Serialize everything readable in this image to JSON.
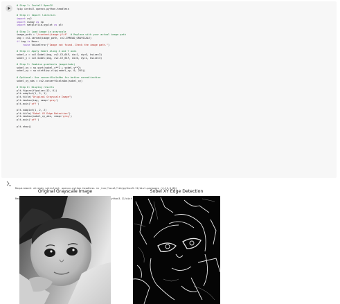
{
  "cell": {
    "code_lines": [
      [
        {
          "t": "# Step 1: Install OpenCV",
          "c": "cmt"
        }
      ],
      [
        {
          "t": "!pip install opencv-python-headless",
          "c": "plain"
        }
      ],
      [],
      [
        {
          "t": "# Step 2: Import libraries",
          "c": "cmt"
        }
      ],
      [
        {
          "t": "import",
          "c": "kw"
        },
        {
          "t": " cv2",
          "c": "plain"
        }
      ],
      [
        {
          "t": "import",
          "c": "kw"
        },
        {
          "t": " numpy ",
          "c": "plain"
        },
        {
          "t": "as",
          "c": "kw"
        },
        {
          "t": " np",
          "c": "plain"
        }
      ],
      [
        {
          "t": "import",
          "c": "kw"
        },
        {
          "t": " matplotlib.pyplot ",
          "c": "plain"
        },
        {
          "t": "as",
          "c": "kw"
        },
        {
          "t": " plt",
          "c": "plain"
        }
      ],
      [],
      [
        {
          "t": "# Step 3: Load image in grayscale",
          "c": "cmt"
        }
      ],
      [
        {
          "t": "image_path = ",
          "c": "plain"
        },
        {
          "t": "\"/content/image.jfif\"",
          "c": "str"
        },
        {
          "t": "  ",
          "c": "plain"
        },
        {
          "t": "# Replace with your actual image path",
          "c": "cmt"
        }
      ],
      [
        {
          "t": "img = cv2.imread(image_path, cv2.IMREAD_GRAYSCALE)",
          "c": "plain"
        }
      ],
      [
        {
          "t": "if",
          "c": "kw"
        },
        {
          "t": " img ",
          "c": "plain"
        },
        {
          "t": "is",
          "c": "kw"
        },
        {
          "t": " None:",
          "c": "plain"
        }
      ],
      [
        {
          "t": "    ",
          "c": "plain"
        },
        {
          "t": "raise",
          "c": "kw"
        },
        {
          "t": " ValueError(",
          "c": "plain"
        },
        {
          "t": "\"Image not found. Check the image path.\"",
          "c": "str"
        },
        {
          "t": ")",
          "c": "plain"
        }
      ],
      [],
      [
        {
          "t": "# Step 4: Apply Sobel along X and Y axes",
          "c": "cmt"
        }
      ],
      [
        {
          "t": "sobel_x = cv2.Sobel(img, cv2.CV_64F, dx=1, dy=0, ksize=3)",
          "c": "plain"
        }
      ],
      [
        {
          "t": "sobel_y = cv2.Sobel(img, cv2.CV_64F, dx=0, dy=1, ksize=3)",
          "c": "plain"
        }
      ],
      [],
      [
        {
          "t": "# Step 5: Combine gradients (magnitude)",
          "c": "cmt"
        }
      ],
      [
        {
          "t": "sobel_xy = np.sqrt(sobel_x**2 + sobel_y**2)",
          "c": "plain"
        }
      ],
      [
        {
          "t": "sobel_xy = np.uint8(np.clip(sobel_xy, 0, 255))",
          "c": "plain"
        }
      ],
      [],
      [
        {
          "t": "# Optional: Use convertScaleAbs for better normalization",
          "c": "cmt"
        }
      ],
      [
        {
          "t": "sobel_xy_abs = cv2.convertScaleAbs(sobel_xy)",
          "c": "plain"
        }
      ],
      [],
      [
        {
          "t": "# Step 6: Display results",
          "c": "cmt"
        }
      ],
      [
        {
          "t": "plt.figure(figsize=(12, 6))",
          "c": "plain"
        }
      ],
      [
        {
          "t": "plt.subplot(1, 2, 1)",
          "c": "plain"
        }
      ],
      [
        {
          "t": "plt.title(",
          "c": "plain"
        },
        {
          "t": "\"Original Grayscale Image\"",
          "c": "str"
        },
        {
          "t": ")",
          "c": "plain"
        }
      ],
      [
        {
          "t": "plt.imshow(img, cmap=",
          "c": "plain"
        },
        {
          "t": "'gray'",
          "c": "str"
        },
        {
          "t": ")",
          "c": "plain"
        }
      ],
      [
        {
          "t": "plt.axis(",
          "c": "plain"
        },
        {
          "t": "'off'",
          "c": "str"
        },
        {
          "t": ")",
          "c": "plain"
        }
      ],
      [],
      [
        {
          "t": "plt.subplot(1, 2, 2)",
          "c": "plain"
        }
      ],
      [
        {
          "t": "plt.title(",
          "c": "plain"
        },
        {
          "t": "\"Sobel XY Edge Detection\"",
          "c": "str"
        },
        {
          "t": ")",
          "c": "plain"
        }
      ],
      [
        {
          "t": "plt.imshow(sobel_xy_abs, cmap=",
          "c": "plain"
        },
        {
          "t": "'gray'",
          "c": "str"
        },
        {
          "t": ")",
          "c": "plain"
        }
      ],
      [
        {
          "t": "plt.axis(",
          "c": "plain"
        },
        {
          "t": "'off'",
          "c": "str"
        },
        {
          "t": ")",
          "c": "plain"
        }
      ],
      [],
      [
        {
          "t": "plt.show()",
          "c": "plain"
        }
      ]
    ]
  },
  "output": {
    "lines": [
      "Requirement already satisfied: opencv-python-headless in /usr/local/lib/python3.11/dist-packages (4.11.0.86)",
      "Requirement already satisfied: numpy>=1.21.2 in /usr/local/lib/python3.11/dist-packages (from opencv-python-headless) (2.0.2)"
    ],
    "plots": {
      "left_title": "Original Grayscale Image",
      "right_title": "Sobel XY Edge Detection"
    }
  },
  "icons": {
    "run": "play-icon",
    "output": "output-settings-icon"
  },
  "colors": {
    "comment": "#1b7d3a",
    "keyword": "#7d3fbf",
    "string": "#b3261e",
    "cell_bg": "#f7f7f7"
  }
}
